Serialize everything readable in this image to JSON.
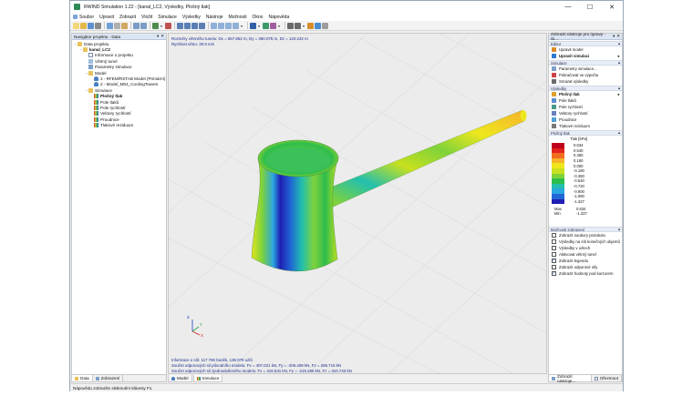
{
  "window": {
    "title": "RWIND Simulation 1.22 - [kanal_LC2, Výsledky, Plošný tlak]",
    "controls": [
      "—",
      "☐",
      "✕"
    ]
  },
  "menu": [
    "Soubor",
    "Upravit",
    "Zobrazit",
    "Vložit",
    "Simulace",
    "Výsledky",
    "Nástroje",
    "Možnosti",
    "Okno",
    "Nápověda"
  ],
  "navigator": {
    "title": "Navigátor projektu - Data",
    "tree": [
      {
        "label": "Data projektu",
        "level": 0,
        "icon": "folder",
        "exp": "−"
      },
      {
        "label": "kanal_LC2",
        "level": 1,
        "icon": "folder",
        "bold": true,
        "exp": "−"
      },
      {
        "label": "Informace o projektu",
        "level": 2,
        "icon": "file"
      },
      {
        "label": "Větrný tunel",
        "level": 2,
        "icon": "tunnel"
      },
      {
        "label": "Parametry simulace",
        "level": 2,
        "icon": "param"
      },
      {
        "label": "Model",
        "level": 2,
        "icon": "folder",
        "exp": "−"
      },
      {
        "label": "1 - RFEM/RSTAB Model (Primární)",
        "level": 3,
        "icon": "person"
      },
      {
        "label": "2 - Model_M04_CoolingTowers",
        "level": 3,
        "icon": "person"
      },
      {
        "label": "Simulace",
        "level": 2,
        "icon": "folder",
        "exp": "−"
      },
      {
        "label": "Plošný tlak",
        "level": 3,
        "icon": "cmap",
        "bold": true
      },
      {
        "label": "Pole tlaků",
        "level": 3,
        "icon": "cmap"
      },
      {
        "label": "Pole rychlostí",
        "level": 3,
        "icon": "cmap"
      },
      {
        "label": "Vektory rychlostí",
        "level": 3,
        "icon": "cmap"
      },
      {
        "label": "Proudnice",
        "level": 3,
        "icon": "cmap"
      },
      {
        "label": "Tlakové reziduum",
        "level": 3,
        "icon": "cmap"
      }
    ],
    "tabs": [
      "Data",
      "Zobrazení"
    ]
  },
  "viewport": {
    "info_top": [
      "Rozměry větrného tunelu: Dx = 657.862 m, Dy = 380.075 m, Dz = 120.242 m",
      "Rychlost větru: 30.8 m/s"
    ],
    "info_bottom": [
      "Informace o síti: 117 760 buněk, 136 079 uzlů",
      "Součet odporových sil původního modelu: Fx = 407.021 kN, Fy = -206.408 kN, Fz = 259.715 kN",
      "Součet odporových sil zjednodušeného modelu: Fx = 416.531 kN, Fy = -219.255 kN, Fz = 310.743 kN"
    ],
    "axes": {
      "z": "Z",
      "x": "X",
      "y": "Y"
    },
    "tabs": [
      "Model",
      "Simulace"
    ]
  },
  "right_panel": {
    "title": "Zobrazit nástroje pro úpravy - Si...",
    "sections": {
      "editor": {
        "title": "Editor",
        "items": [
          {
            "label": "Upravit model",
            "icon": "edit-icon"
          },
          {
            "label": "Upravit simulaci",
            "icon": "edit-sim-icon",
            "bold": true,
            "arrow": "◂"
          }
        ]
      },
      "simulace": {
        "title": "Simulace",
        "items": [
          {
            "label": "Parametry simulace...",
            "icon": "params-icon"
          },
          {
            "label": "Pokračovat ve výpočtu",
            "icon": "continue-icon"
          },
          {
            "label": "Smazat výsledky",
            "icon": "delete-icon"
          }
        ]
      },
      "vysledky": {
        "title": "Výsledky",
        "items": [
          {
            "label": "Plošný tlak",
            "icon": "pressure-icon",
            "bold": true,
            "arrow": "◂"
          },
          {
            "label": "Pole tlaků",
            "icon": "pressure-field-icon"
          },
          {
            "label": "Pole rychlostí",
            "icon": "velocity-field-icon"
          },
          {
            "label": "Vektory rychlostí",
            "icon": "vectors-icon"
          },
          {
            "label": "Proudnice",
            "icon": "streamlines-icon"
          },
          {
            "label": "Tlakové reziduum",
            "icon": "residual-icon"
          }
        ]
      },
      "plosny_tlak": {
        "title": "Plošný tlak",
        "unit": "Tlak [kPa]",
        "scale": [
          {
            "value": "0.634",
            "color": "#c0001a"
          },
          {
            "value": "0.540",
            "color": "#e2221e"
          },
          {
            "value": "0.360",
            "color": "#f36d21"
          },
          {
            "value": "0.180",
            "color": "#f6b22a"
          },
          {
            "value": "0.000",
            "color": "#eee71e"
          },
          {
            "value": "-0.180",
            "color": "#c8e01e"
          },
          {
            "value": "-0.360",
            "color": "#7fd23a"
          },
          {
            "value": "-0.540",
            "color": "#2dbd4c"
          },
          {
            "value": "-0.720",
            "color": "#22bfae"
          },
          {
            "value": "-0.900",
            "color": "#2aa6e1"
          },
          {
            "value": "-1.080",
            "color": "#2066d4"
          },
          {
            "value": "-1.327",
            "color": "#1f1fb4"
          }
        ],
        "max_label": "Max",
        "max_value": "0.634",
        "min_label": "Min",
        "min_value": "-1.327"
      },
      "moznosti": {
        "title": "Možnosti zobrazení",
        "items": [
          {
            "label": "Zobrazit soubory protokolu",
            "checked": false
          },
          {
            "label": "Výsledky na síti konečných objemů",
            "checked": false
          },
          {
            "label": "Výsledky v uzlech",
            "checked": false
          },
          {
            "label": "Aktivovat větrný tunel",
            "checked": false
          },
          {
            "label": "Zobrazit legendu",
            "checked": true
          },
          {
            "label": "Zobrazit odporové síly",
            "checked": false
          },
          {
            "label": "Zobrazit hodnoty pod kurzorem",
            "checked": true
          }
        ]
      }
    },
    "tabs": [
      "Zobrazit nástroje...",
      "Ořezmout"
    ]
  },
  "statusbar": "Nápovědu zobrazíte stisknutím klávesy F1."
}
